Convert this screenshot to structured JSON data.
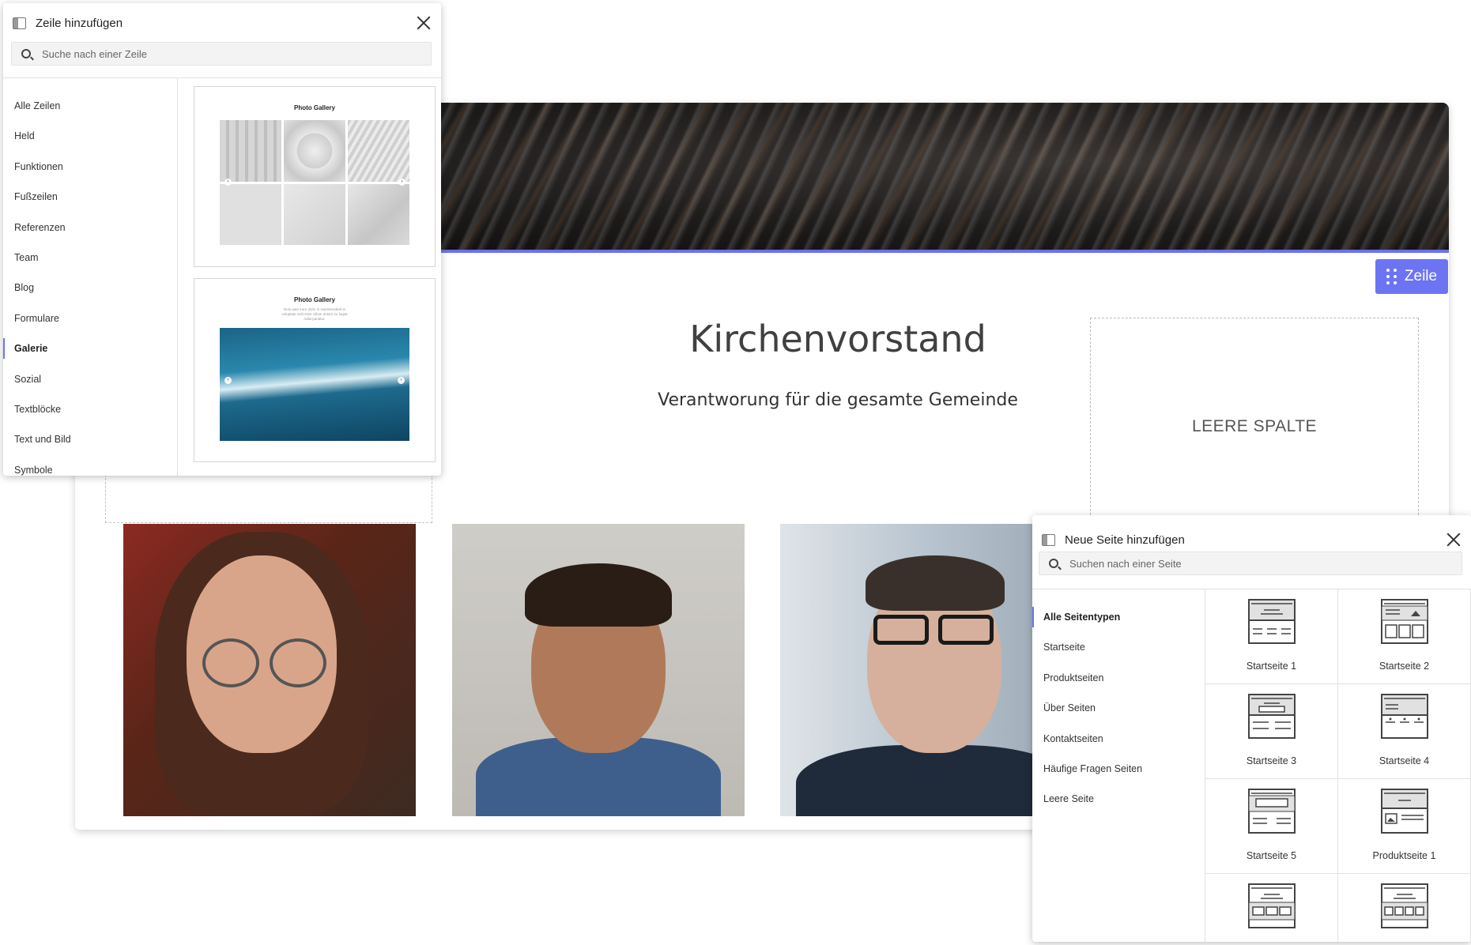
{
  "editor": {
    "row_button_label": "Zeile",
    "heading": "Kirchenvorstand",
    "subheading": "Verantworung für die gesamte Gemeinde",
    "empty_column_label": "LEERE SPALTE",
    "accent_color": "#6c74f2"
  },
  "row_panel": {
    "title": "Zeile hinzufügen",
    "search_placeholder": "Suche nach einer Zeile",
    "categories": [
      "Alle Zeilen",
      "Held",
      "Funktionen",
      "Fußzeilen",
      "Referenzen",
      "Team",
      "Blog",
      "Formulare",
      "Galerie",
      "Sozial",
      "Textblöcke",
      "Text und Bild",
      "Symbole"
    ],
    "active_category": "Galerie",
    "templates": [
      {
        "title": "Photo Gallery",
        "subtitle": ""
      },
      {
        "title": "Photo Gallery",
        "subtitle": "Duis aute irure dolor in reprehenderit in voluptate velit esse cillum dolore eu fugiat nulla pariatur."
      }
    ]
  },
  "page_panel": {
    "title": "Neue Seite hinzufügen",
    "search_placeholder": "Suchen nach einer Seite",
    "categories": [
      "Alle Seitentypen",
      "Startseite",
      "Produktseiten",
      "Über Seiten",
      "Kontaktseiten",
      "Häufige Fragen Seiten",
      "Leere Seite"
    ],
    "active_category": "Alle Seitentypen",
    "templates": [
      "Startseite 1",
      "Startseite 2",
      "Startseite 3",
      "Startseite 4",
      "Startseite 5",
      "Produktseite 1",
      "",
      ""
    ]
  }
}
